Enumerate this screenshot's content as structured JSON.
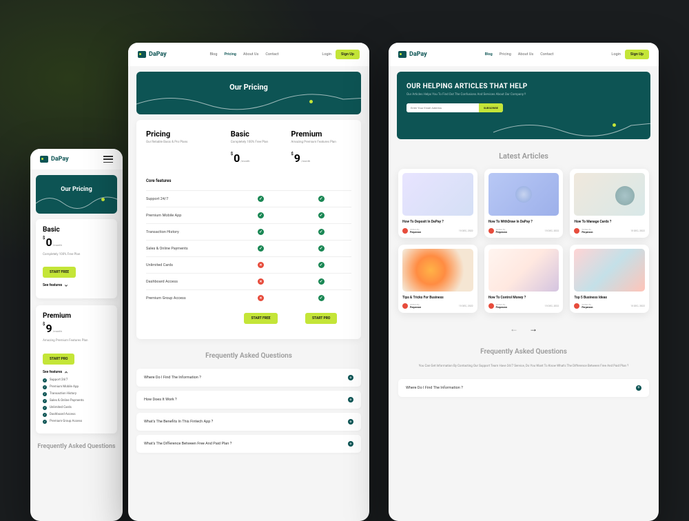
{
  "brand": "DaPay",
  "nav": {
    "blog": "Blog",
    "pricing": "Pricing",
    "about": "About Us",
    "contact": "Contact"
  },
  "auth": {
    "login": "Login",
    "signup": "Sign Up"
  },
  "hero": {
    "pricing_title": "Our Pricing",
    "blog_title": "OUR HELPING ARTICLES THAT HELP",
    "blog_sub": "Our Articles Helps You To Find Out The Confusions And Services About Our Company !!",
    "email_placeholder": "Enter Your Email Address",
    "subscribe": "SUBSCRIBE"
  },
  "plans": {
    "basic": {
      "name": "Basic",
      "currency": "$",
      "price": "0",
      "period": "/month",
      "desc": "Completely 100% Free Plan",
      "cta": "START FREE"
    },
    "premium": {
      "name": "Premium",
      "currency": "$",
      "price": "9",
      "period": "/month",
      "desc": "Amazing Premium Features Plan",
      "cta": "START PRO"
    },
    "see_features": "See features"
  },
  "pricing_table": {
    "title": "Pricing",
    "sub": "Our Reliable Basic & Pro Plans",
    "core_label": "Core features",
    "features": [
      {
        "name": "Support 24/7",
        "basic": true,
        "premium": true
      },
      {
        "name": "Premium Mobile App",
        "basic": true,
        "premium": true
      },
      {
        "name": "Transaction History",
        "basic": true,
        "premium": true
      },
      {
        "name": "Sales & Online Payments",
        "basic": true,
        "premium": true
      },
      {
        "name": "Unlimited Cards",
        "basic": false,
        "premium": true
      },
      {
        "name": "Dashboard Access",
        "basic": false,
        "premium": true
      },
      {
        "name": "Premium Group Access",
        "basic": false,
        "premium": true
      }
    ]
  },
  "faq": {
    "title": "Frequently Asked Questions",
    "intro": "You Can Get Information By Contacting Our Support Team Have 24/7 Service, Do You Want To Know What's The Difference Between Free And Paid Plan ?",
    "items": [
      "Where Do I Find The Information ?",
      "How Does It Work ?",
      "What's The Benefits In This Fintech App ?",
      "What's The Difference Between Free And Paid Plan ?"
    ]
  },
  "blog": {
    "section_title": "Latest Articles",
    "author_label": "Written By",
    "author_name": "Perperzon",
    "date": "15 DEC, 2022",
    "articles": [
      "How To Deposit In DaPay ?",
      "How To WithDraw In DaPay ?",
      "How To Manage Cards ?",
      "Tips & Tricks For Business",
      "How To Control Money ?",
      "Top 5 Business Ideas"
    ]
  }
}
